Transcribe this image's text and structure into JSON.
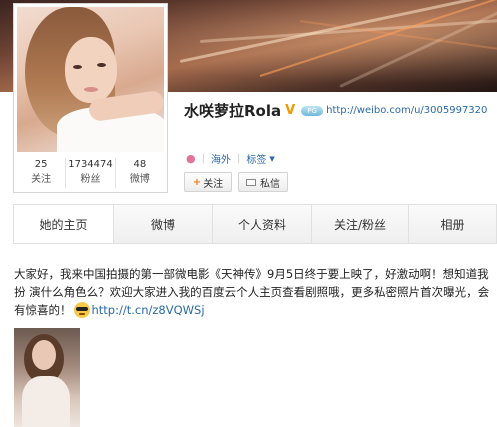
{
  "profile": {
    "name": "水咲萝拉Rola",
    "verified_mark": "V",
    "level_badge": "PG",
    "url": "http://weibo.com/u/3005997320",
    "gender_icon": "female-icon",
    "location": "海外",
    "tags_label": "标签",
    "stats": [
      {
        "value": "25",
        "label": "关注"
      },
      {
        "value": "1734474",
        "label": "粉丝"
      },
      {
        "value": "48",
        "label": "微博"
      }
    ],
    "follow_button": "关注",
    "message_button": "私信"
  },
  "tabs": [
    "她的主页",
    "微博",
    "个人资料",
    "关注/粉丝",
    "相册"
  ],
  "post": {
    "text": "大家好，我来中国拍摄的第一部微电影《天神传》9月5日终于要上映了，好激动啊！想知道我扮 演什么角色么？欢迎大家进入我的百度云个人主页查看剧照哦，更多私密照片首次曝光，会有惊喜的！",
    "emoji": "cool-sunglasses-emoji",
    "link": "http://t.cn/z8VQWSj"
  },
  "colors": {
    "link": "#2a6aa8",
    "verified": "#f09a00",
    "follow_plus": "#f37b1d"
  }
}
